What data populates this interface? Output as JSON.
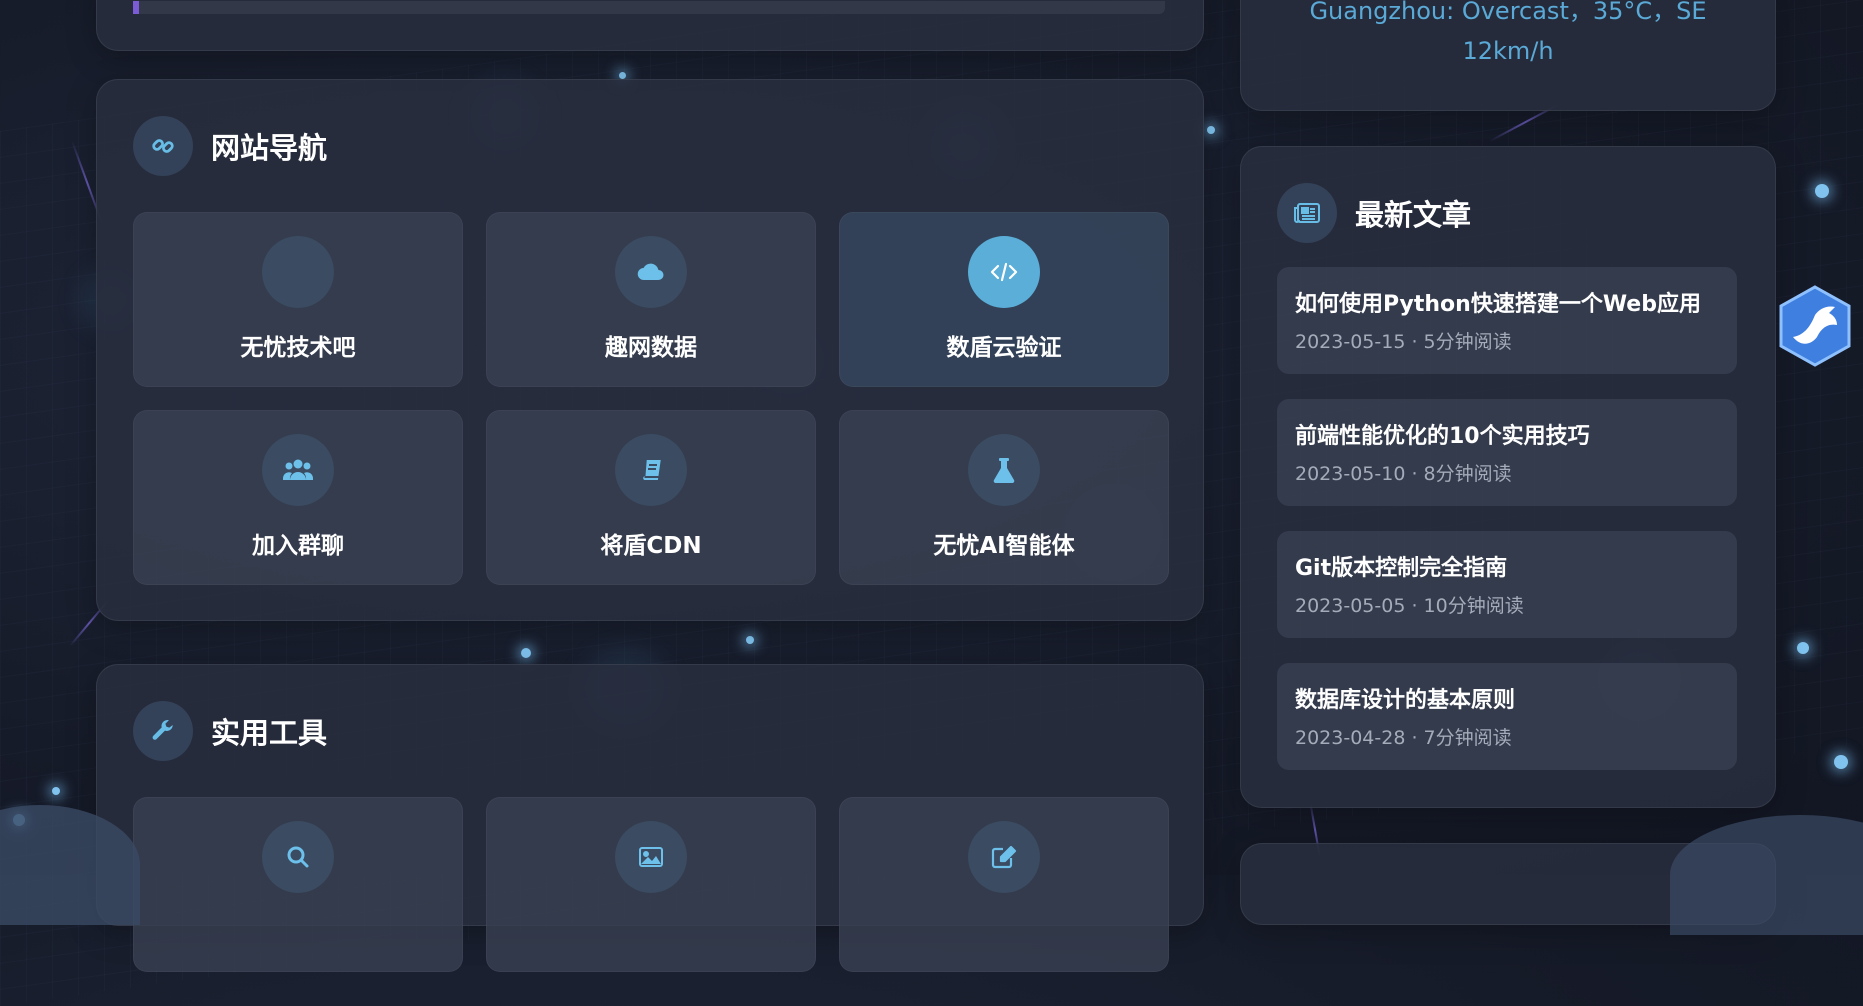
{
  "nav": {
    "title": "网站导航",
    "icon": "link-icon",
    "items": [
      {
        "label": "无忧技术吧",
        "icon": "blank-circle-icon"
      },
      {
        "label": "趣网数据",
        "icon": "cloud-icon"
      },
      {
        "label": "数盾云验证",
        "icon": "code-icon",
        "active": true
      },
      {
        "label": "加入群聊",
        "icon": "users-icon"
      },
      {
        "label": "将盾CDN",
        "icon": "book-icon"
      },
      {
        "label": "无忧AI智能体",
        "icon": "flask-icon"
      }
    ]
  },
  "tools": {
    "title": "实用工具",
    "icon": "wrench-icon",
    "items": [
      {
        "icon": "search-icon"
      },
      {
        "icon": "image-icon"
      },
      {
        "icon": "edit-icon"
      }
    ]
  },
  "weather": {
    "line1": "Guangzhou: Overcast，35°C，SE",
    "line2": "12km/h"
  },
  "articles": {
    "title": "最新文章",
    "icon": "newspaper-icon",
    "items": [
      {
        "title": "如何使用Python快速搭建一个Web应用",
        "meta": "2023-05-15 · 5分钟阅读"
      },
      {
        "title": "前端性能优化的10个实用技巧",
        "meta": "2023-05-10 · 8分钟阅读"
      },
      {
        "title": "Git版本控制完全指南",
        "meta": "2023-05-05 · 10分钟阅读"
      },
      {
        "title": "数据库设计的基本原则",
        "meta": "2023-04-28 · 7分钟阅读"
      }
    ]
  },
  "colors": {
    "accent": "#5aaed8",
    "icon_blue": "#67bde6",
    "card_bg": "#282e3e",
    "meta_text": "#a4abb9"
  }
}
